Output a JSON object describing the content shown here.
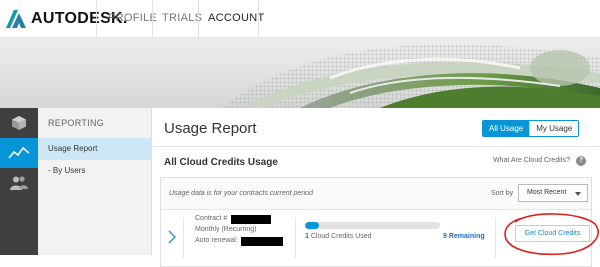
{
  "brand": {
    "logo_text": "AUTODESK."
  },
  "nav": {
    "items": [
      {
        "label": "PROFILE"
      },
      {
        "label": "TRIALS"
      },
      {
        "label": "ACCOUNT"
      }
    ]
  },
  "rail": {
    "icons": [
      "cube-icon",
      "usage-chart-icon",
      "users-icon"
    ]
  },
  "subnav": {
    "title": "REPORTING",
    "items": [
      {
        "label": "Usage Report"
      },
      {
        "label": "- By Users"
      }
    ]
  },
  "main": {
    "title": "Usage Report",
    "view_toggle": {
      "options": [
        "All Usage",
        "My Usage"
      ],
      "selected": "All Usage"
    },
    "section_title": "All Cloud Credits Usage",
    "help_link": "What Are Cloud Credits?",
    "help_icon_glyph": "?",
    "card": {
      "note": "Usage data is for your contracts current period",
      "sort_label": "Sort by",
      "sort_value": "Most Recent",
      "contract": {
        "name": "Contract #",
        "billing": "Monthly (Recurring)",
        "renewal_label": "Auto renewal:"
      },
      "credits_used": {
        "value": "1",
        "label": "Cloud Credits Used"
      },
      "credits_remaining": {
        "value": "9",
        "label": "Remaining"
      },
      "usage_fraction": 0.1,
      "button_label": "Get Cloud Credits"
    }
  },
  "colors": {
    "accent": "#0696d7",
    "rail": "#3f3f3f",
    "annotation": "#e0201c"
  }
}
